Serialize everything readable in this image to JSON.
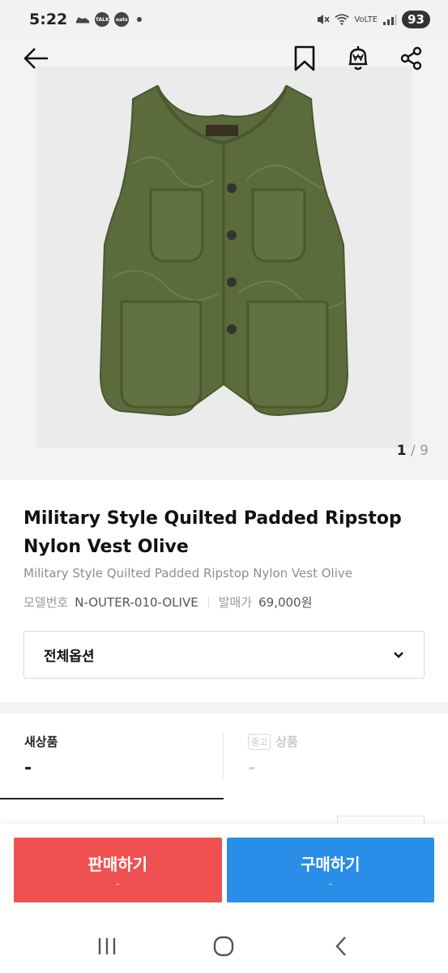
{
  "status_bar": {
    "time": "5:22",
    "talk_badge": "TALK",
    "eats_badge": "eats",
    "volte": "VoLTE",
    "battery": "93"
  },
  "header": {
    "icons": [
      "back-arrow-icon",
      "bookmark-icon",
      "price-alert-icon",
      "share-icon"
    ]
  },
  "gallery": {
    "current": "1",
    "separator": " / ",
    "total": "9"
  },
  "product": {
    "title": "Military Style Quilted Padded Ripstop Nylon Vest Olive",
    "subtitle": "Military Style Quilted Padded Ripstop Nylon Vest Olive",
    "model_label": "모델번호",
    "model_value": "N-OUTER-010-OLIVE",
    "release_label": "발매가",
    "release_value": "69,000원"
  },
  "options": {
    "selected": "전체옵션"
  },
  "tabs": {
    "new_label": "새상품",
    "new_price": "-",
    "used_badge": "중고",
    "used_label": "상품",
    "used_price": "-"
  },
  "actions": {
    "sell_label": "판매하기",
    "sell_price": "-",
    "buy_label": "구매하기",
    "buy_price": "-"
  },
  "colors": {
    "sell": "#ef5150",
    "buy": "#2a8de8",
    "vest_olive": "#5c6b3c"
  }
}
